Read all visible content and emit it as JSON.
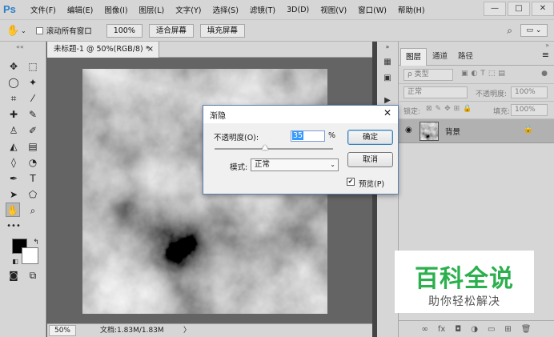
{
  "app": {
    "logo": "Ps",
    "menu": [
      "文件(F)",
      "编辑(E)",
      "图像(I)",
      "图层(L)",
      "文字(Y)",
      "选择(S)",
      "滤镜(T)",
      "3D(D)",
      "视图(V)",
      "窗口(W)",
      "帮助(H)"
    ],
    "window_controls": [
      "—",
      "□",
      "✕"
    ]
  },
  "options_bar": {
    "scroll_all_label": "滚动所有窗口",
    "zoom_value": "100%",
    "fit_screen_label": "适合屏幕",
    "fill_screen_label": "填充屏幕"
  },
  "document": {
    "tab_title": "未标题-1 @ 50%(RGB/8) *",
    "close_glyph": "×",
    "zoom": "50%",
    "doc_info": "文档:1.83M/1.83M",
    "status_arrow": "〉"
  },
  "layers_panel": {
    "tabs": [
      "图层",
      "通道",
      "路径"
    ],
    "filter_placeholder": "ρ 类型",
    "blend_mode": "正常",
    "opacity_label": "不透明度:",
    "opacity_value": "100%",
    "lock_label": "锁定:",
    "fill_label": "填充:",
    "fill_value": "100%",
    "layer_name": "背景",
    "footer_icons": [
      "link-icon",
      "fx-icon",
      "mask-icon",
      "adjustment-icon",
      "group-icon",
      "new-layer-icon",
      "trash-icon"
    ]
  },
  "fade_dialog": {
    "title": "渐隐",
    "opacity_label": "不透明度(O):",
    "opacity_value": "35",
    "opacity_unit": "%",
    "opacity_fraction": 0.35,
    "mode_label": "模式:",
    "mode_value": "正常",
    "ok_label": "确定",
    "cancel_label": "取消",
    "preview_label": "预览(P)",
    "preview_checked": true
  },
  "watermark": {
    "title": "百科全说",
    "subtitle": "助你轻松解决"
  },
  "colors": {
    "ps_blue": "#2d7fc9",
    "watermark_green": "#2bb04d",
    "canvas_bg": "#646464"
  }
}
